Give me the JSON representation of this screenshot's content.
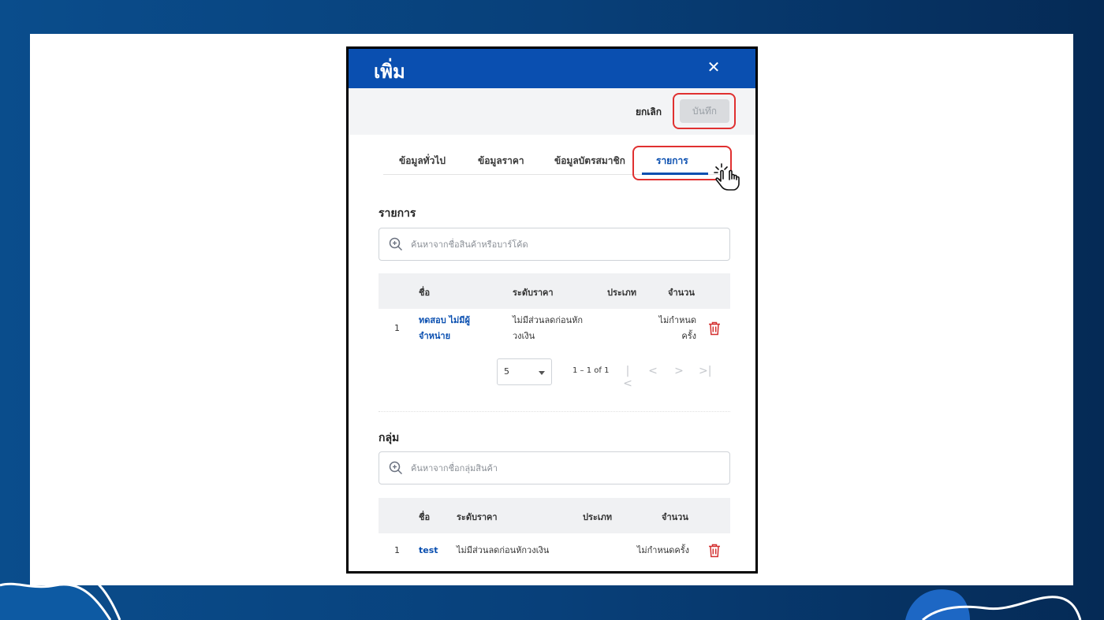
{
  "dialog": {
    "title": "เพิ่ม",
    "close_icon": "close-icon",
    "cancel_label": "ยกเลิก",
    "save_label": "บันทึก"
  },
  "tabs": [
    {
      "label": "ข้อมูลทั่วไป",
      "active": false
    },
    {
      "label": "ข้อมูลราคา",
      "active": false
    },
    {
      "label": "ข้อมูลบัตรสมาชิก",
      "active": false
    },
    {
      "label": "รายการ",
      "active": true
    }
  ],
  "items_section": {
    "title": "รายการ",
    "search_placeholder": "ค้นหาจากชื่อสินค้าหรือบาร์โค้ด",
    "columns": [
      "ชื่อ",
      "ระดับราคา",
      "ประเภท",
      "จำนวน"
    ],
    "rows": [
      {
        "index": "1",
        "name_line1": "ทดสอบ ไม่มีผู้",
        "name_line2": "จำหน่าย",
        "price_line1": "ไม่มีส่วนลดก่อนหัก",
        "price_line2": "วงเงิน",
        "type": "",
        "qty_line1": "ไม่กำหนด",
        "qty_line2": "ครั้ง"
      }
    ],
    "pagination": {
      "page_size": "5",
      "range": "1 – 1 of 1"
    }
  },
  "groups_section": {
    "title": "กลุ่ม",
    "search_placeholder": "ค้นหาจากชื่อกลุ่มสินค้า",
    "columns": [
      "ชื่อ",
      "ระดับราคา",
      "ประเภท",
      "จำนวน"
    ],
    "rows": [
      {
        "index": "1",
        "name": "test",
        "price": "ไม่มีส่วนลดก่อนหักวงเงิน",
        "type": "",
        "qty": "ไม่กำหนดครั้ง"
      }
    ]
  },
  "colors": {
    "primary": "#0a4fb0",
    "highlight": "#e03030",
    "delete": "#d32f2f",
    "background": "#0a4d8c"
  }
}
